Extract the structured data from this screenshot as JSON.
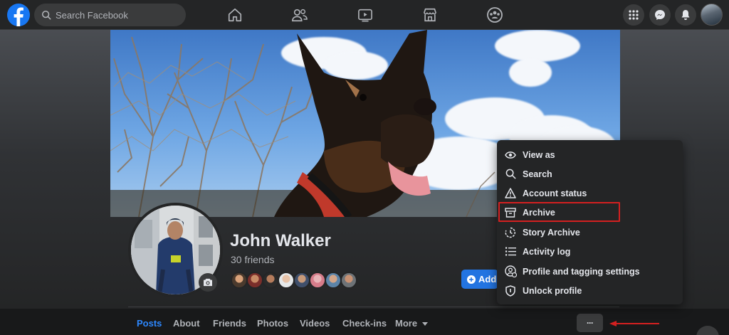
{
  "topbar": {
    "search_placeholder": "Search Facebook",
    "nav_icons": [
      "home-icon",
      "friends-icon",
      "watch-icon",
      "marketplace-icon",
      "groups-icon"
    ],
    "right_icons": [
      "menu-grid-icon",
      "messenger-icon",
      "notifications-icon"
    ]
  },
  "profile": {
    "name": "John Walker",
    "friends_count": "30 friends",
    "add_button_label": "Add"
  },
  "tabs": [
    {
      "label": "Posts",
      "active": true
    },
    {
      "label": "About"
    },
    {
      "label": "Friends"
    },
    {
      "label": "Photos"
    },
    {
      "label": "Videos"
    },
    {
      "label": "Check-ins"
    },
    {
      "label": "More"
    }
  ],
  "more_button_label": "···",
  "menu": {
    "items": [
      {
        "label": "View as",
        "icon": "eye-icon"
      },
      {
        "label": "Search",
        "icon": "search-icon"
      },
      {
        "label": "Account status",
        "icon": "warning-icon"
      },
      {
        "label": "Archive",
        "icon": "archive-icon",
        "highlighted": true
      },
      {
        "label": "Story Archive",
        "icon": "story-archive-icon"
      },
      {
        "label": "Activity log",
        "icon": "list-icon"
      },
      {
        "label": "Profile and tagging settings",
        "icon": "profile-settings-icon"
      },
      {
        "label": "Unlock profile",
        "icon": "shield-icon"
      }
    ]
  },
  "colors": {
    "accent": "#2d88ff",
    "highlight_border": "#d42020",
    "background": "#18191a",
    "surface": "#242526"
  }
}
